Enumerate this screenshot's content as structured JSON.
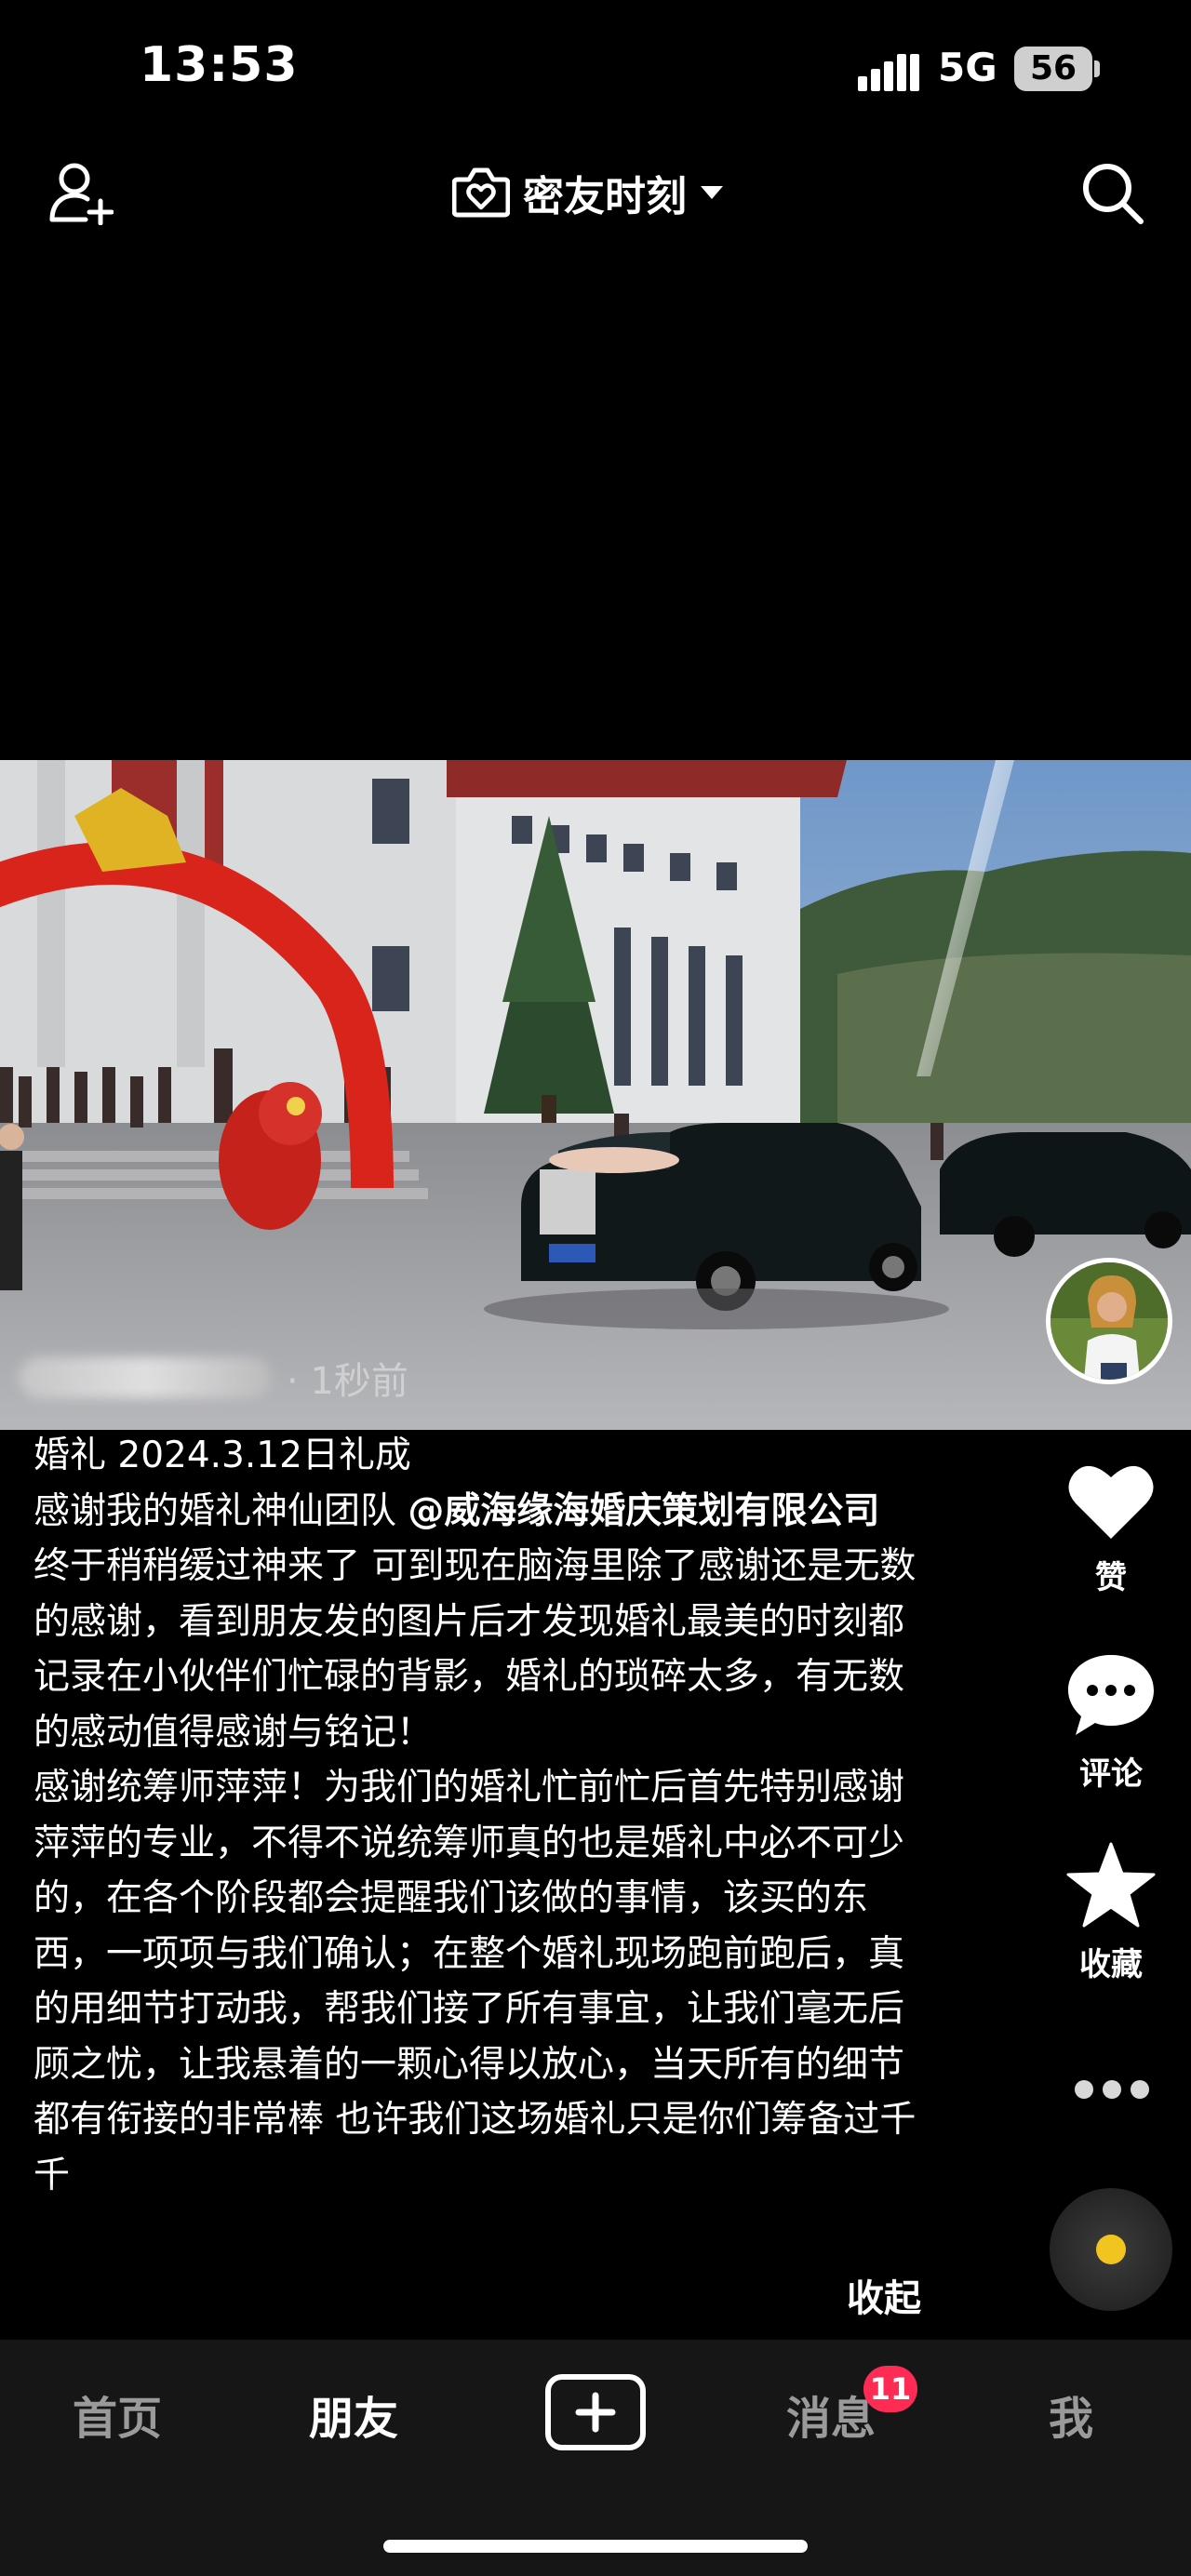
{
  "status_bar": {
    "time": "13:53",
    "network": "5G",
    "battery": "56"
  },
  "top_nav": {
    "title": "密友时刻"
  },
  "post": {
    "time_ago": "· 1秒前",
    "caption": {
      "line1": "婚礼 2024.3.12日礼成",
      "line2_prefix": "感谢我的婚礼神仙团队 ",
      "mention": "@威海缘海婚庆策划有限公司",
      "para1": "终于稍稍缓过神来了 可到现在脑海里除了感谢还是无数的感谢，看到朋友发的图片后才发现婚礼最美的时刻都记录在小伙伴们忙碌的背影，婚礼的琐碎太多，有无数的感动值得感谢与铭记！",
      "para2": "感谢统筹师萍萍！为我们的婚礼忙前忙后首先特别感谢萍萍的专业，不得不说统筹师真的也是婚礼中必不可少的，在各个阶段都会提醒我们该做的事情，该买的东西，一项项与我们确认；在整个婚礼现场跑前跑后，真的用细节打动我，帮我们接了所有事宜，让我们毫无后顾之忧，让我悬着的一颗心得以放心，当天所有的细节都有衔接的非常棒 也许我们这场婚礼只是你们筹备过千千"
    },
    "collapse_label": "收起",
    "actions": {
      "like": "赞",
      "comment": "评论",
      "favorite": "收藏"
    }
  },
  "tab_bar": {
    "home": "首页",
    "friends": "朋友",
    "messages": "消息",
    "messages_badge": "11",
    "me": "我"
  }
}
